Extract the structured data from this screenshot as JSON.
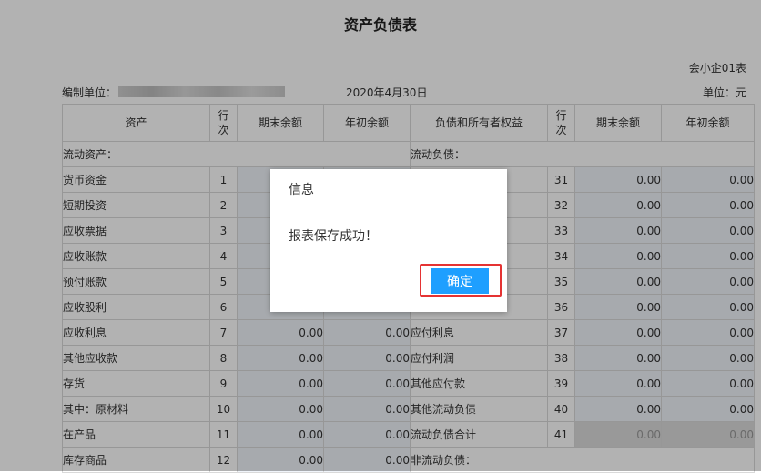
{
  "report": {
    "title": "资产负债表",
    "form_code": "会小企01表",
    "unit_label": "编制单位：",
    "date": "2020年4月30日",
    "currency_label": "单位：元"
  },
  "headers": {
    "asset": "资产",
    "line_no": "行次",
    "end_balance": "期末余额",
    "begin_balance": "年初余额",
    "liability": "负债和所有者权益"
  },
  "rows": [
    {
      "a_name": "流动资产：",
      "a_line": "",
      "a_end": "",
      "a_begin": "",
      "l_name": "流动负债：",
      "l_line": "",
      "l_end": "",
      "l_begin": ""
    },
    {
      "a_name": "货币资金",
      "a_line": "1",
      "a_end": "",
      "a_begin": "",
      "l_name": "",
      "l_line": "31",
      "l_end": "0.00",
      "l_begin": "0.00"
    },
    {
      "a_name": "短期投资",
      "a_line": "2",
      "a_end": "",
      "a_begin": "",
      "l_name": "",
      "l_line": "32",
      "l_end": "0.00",
      "l_begin": "0.00"
    },
    {
      "a_name": "应收票据",
      "a_line": "3",
      "a_end": "",
      "a_begin": "",
      "l_name": "",
      "l_line": "33",
      "l_end": "0.00",
      "l_begin": "0.00"
    },
    {
      "a_name": "应收账款",
      "a_line": "4",
      "a_end": "",
      "a_begin": "",
      "l_name": "",
      "l_line": "34",
      "l_end": "0.00",
      "l_begin": "0.00"
    },
    {
      "a_name": "预付账款",
      "a_line": "5",
      "a_end": "",
      "a_begin": "",
      "l_name": "",
      "l_line": "35",
      "l_end": "0.00",
      "l_begin": "0.00"
    },
    {
      "a_name": "应收股利",
      "a_line": "6",
      "a_end": "",
      "a_begin": "",
      "l_name": "",
      "l_line": "36",
      "l_end": "0.00",
      "l_begin": "0.00"
    },
    {
      "a_name": "应收利息",
      "a_line": "7",
      "a_end": "0.00",
      "a_begin": "0.00",
      "l_name": "应付利息",
      "l_line": "37",
      "l_end": "0.00",
      "l_begin": "0.00"
    },
    {
      "a_name": "其他应收款",
      "a_line": "8",
      "a_end": "0.00",
      "a_begin": "0.00",
      "l_name": "应付利润",
      "l_line": "38",
      "l_end": "0.00",
      "l_begin": "0.00"
    },
    {
      "a_name": "存货",
      "a_line": "9",
      "a_end": "0.00",
      "a_begin": "0.00",
      "l_name": "其他应付款",
      "l_line": "39",
      "l_end": "0.00",
      "l_begin": "0.00"
    },
    {
      "a_name": "其中：原材料",
      "a_line": "10",
      "a_end": "0.00",
      "a_begin": "0.00",
      "l_name": "其他流动负债",
      "l_line": "40",
      "l_end": "0.00",
      "l_begin": "0.00"
    },
    {
      "a_name": "在产品",
      "a_line": "11",
      "a_end": "0.00",
      "a_begin": "0.00",
      "l_name": "流动负债合计",
      "l_line": "41",
      "l_end": "0.00",
      "l_begin": "0.00"
    },
    {
      "a_name": "库存商品",
      "a_line": "12",
      "a_end": "0.00",
      "a_begin": "0.00",
      "l_name": "非流动负债：",
      "l_line": "",
      "l_end": "",
      "l_begin": ""
    }
  ],
  "dialog": {
    "title": "信息",
    "message": "报表保存成功！",
    "ok_label": "确定"
  },
  "colors": {
    "ok_button": "#1e9fff",
    "highlight_border": "#e53333",
    "overlay": "rgba(0,0,0,0.3)"
  }
}
